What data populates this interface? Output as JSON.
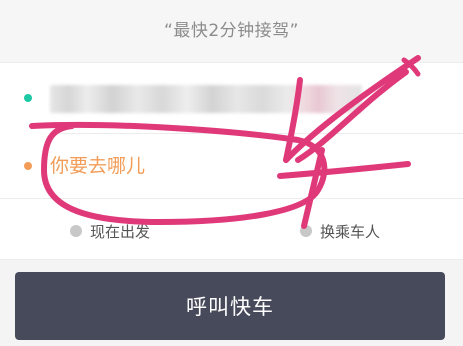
{
  "slogan": "“最快2分钟接驾”",
  "origin": {
    "value": ""
  },
  "destination": {
    "placeholder": "你要去哪儿"
  },
  "options": {
    "depart_now": "现在出发",
    "switch_passenger": "换乘车人"
  },
  "call_button": "呼叫快车",
  "colors": {
    "origin_dot": "#1ec8a5",
    "destination_dot": "#f39c57",
    "button_bg": "#474a5a",
    "scribble": "#e0397a"
  }
}
